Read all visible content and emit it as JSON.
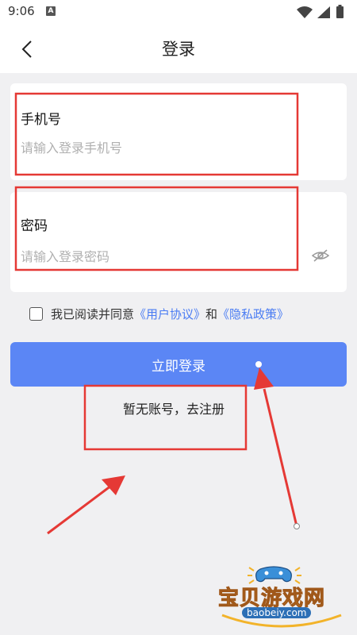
{
  "status": {
    "time": "9:06",
    "badge": "A"
  },
  "header": {
    "title": "登录"
  },
  "form": {
    "phone_label": "手机号",
    "phone_placeholder": "请输入登录手机号",
    "password_label": "密码",
    "password_placeholder": "请输入登录密码"
  },
  "agreement": {
    "prefix": "我已阅读并同意",
    "user_agreement": "《用户协议》",
    "and": "和",
    "privacy_policy": "《隐私政策》"
  },
  "login_button": "立即登录",
  "register_link": "暂无账号，去注册",
  "watermark": {
    "name": "宝贝游戏网",
    "domain": "baobeiy.com"
  },
  "colors": {
    "primary": "#5b86f5",
    "link": "#4a7cf3",
    "annotation": "#e53935"
  }
}
